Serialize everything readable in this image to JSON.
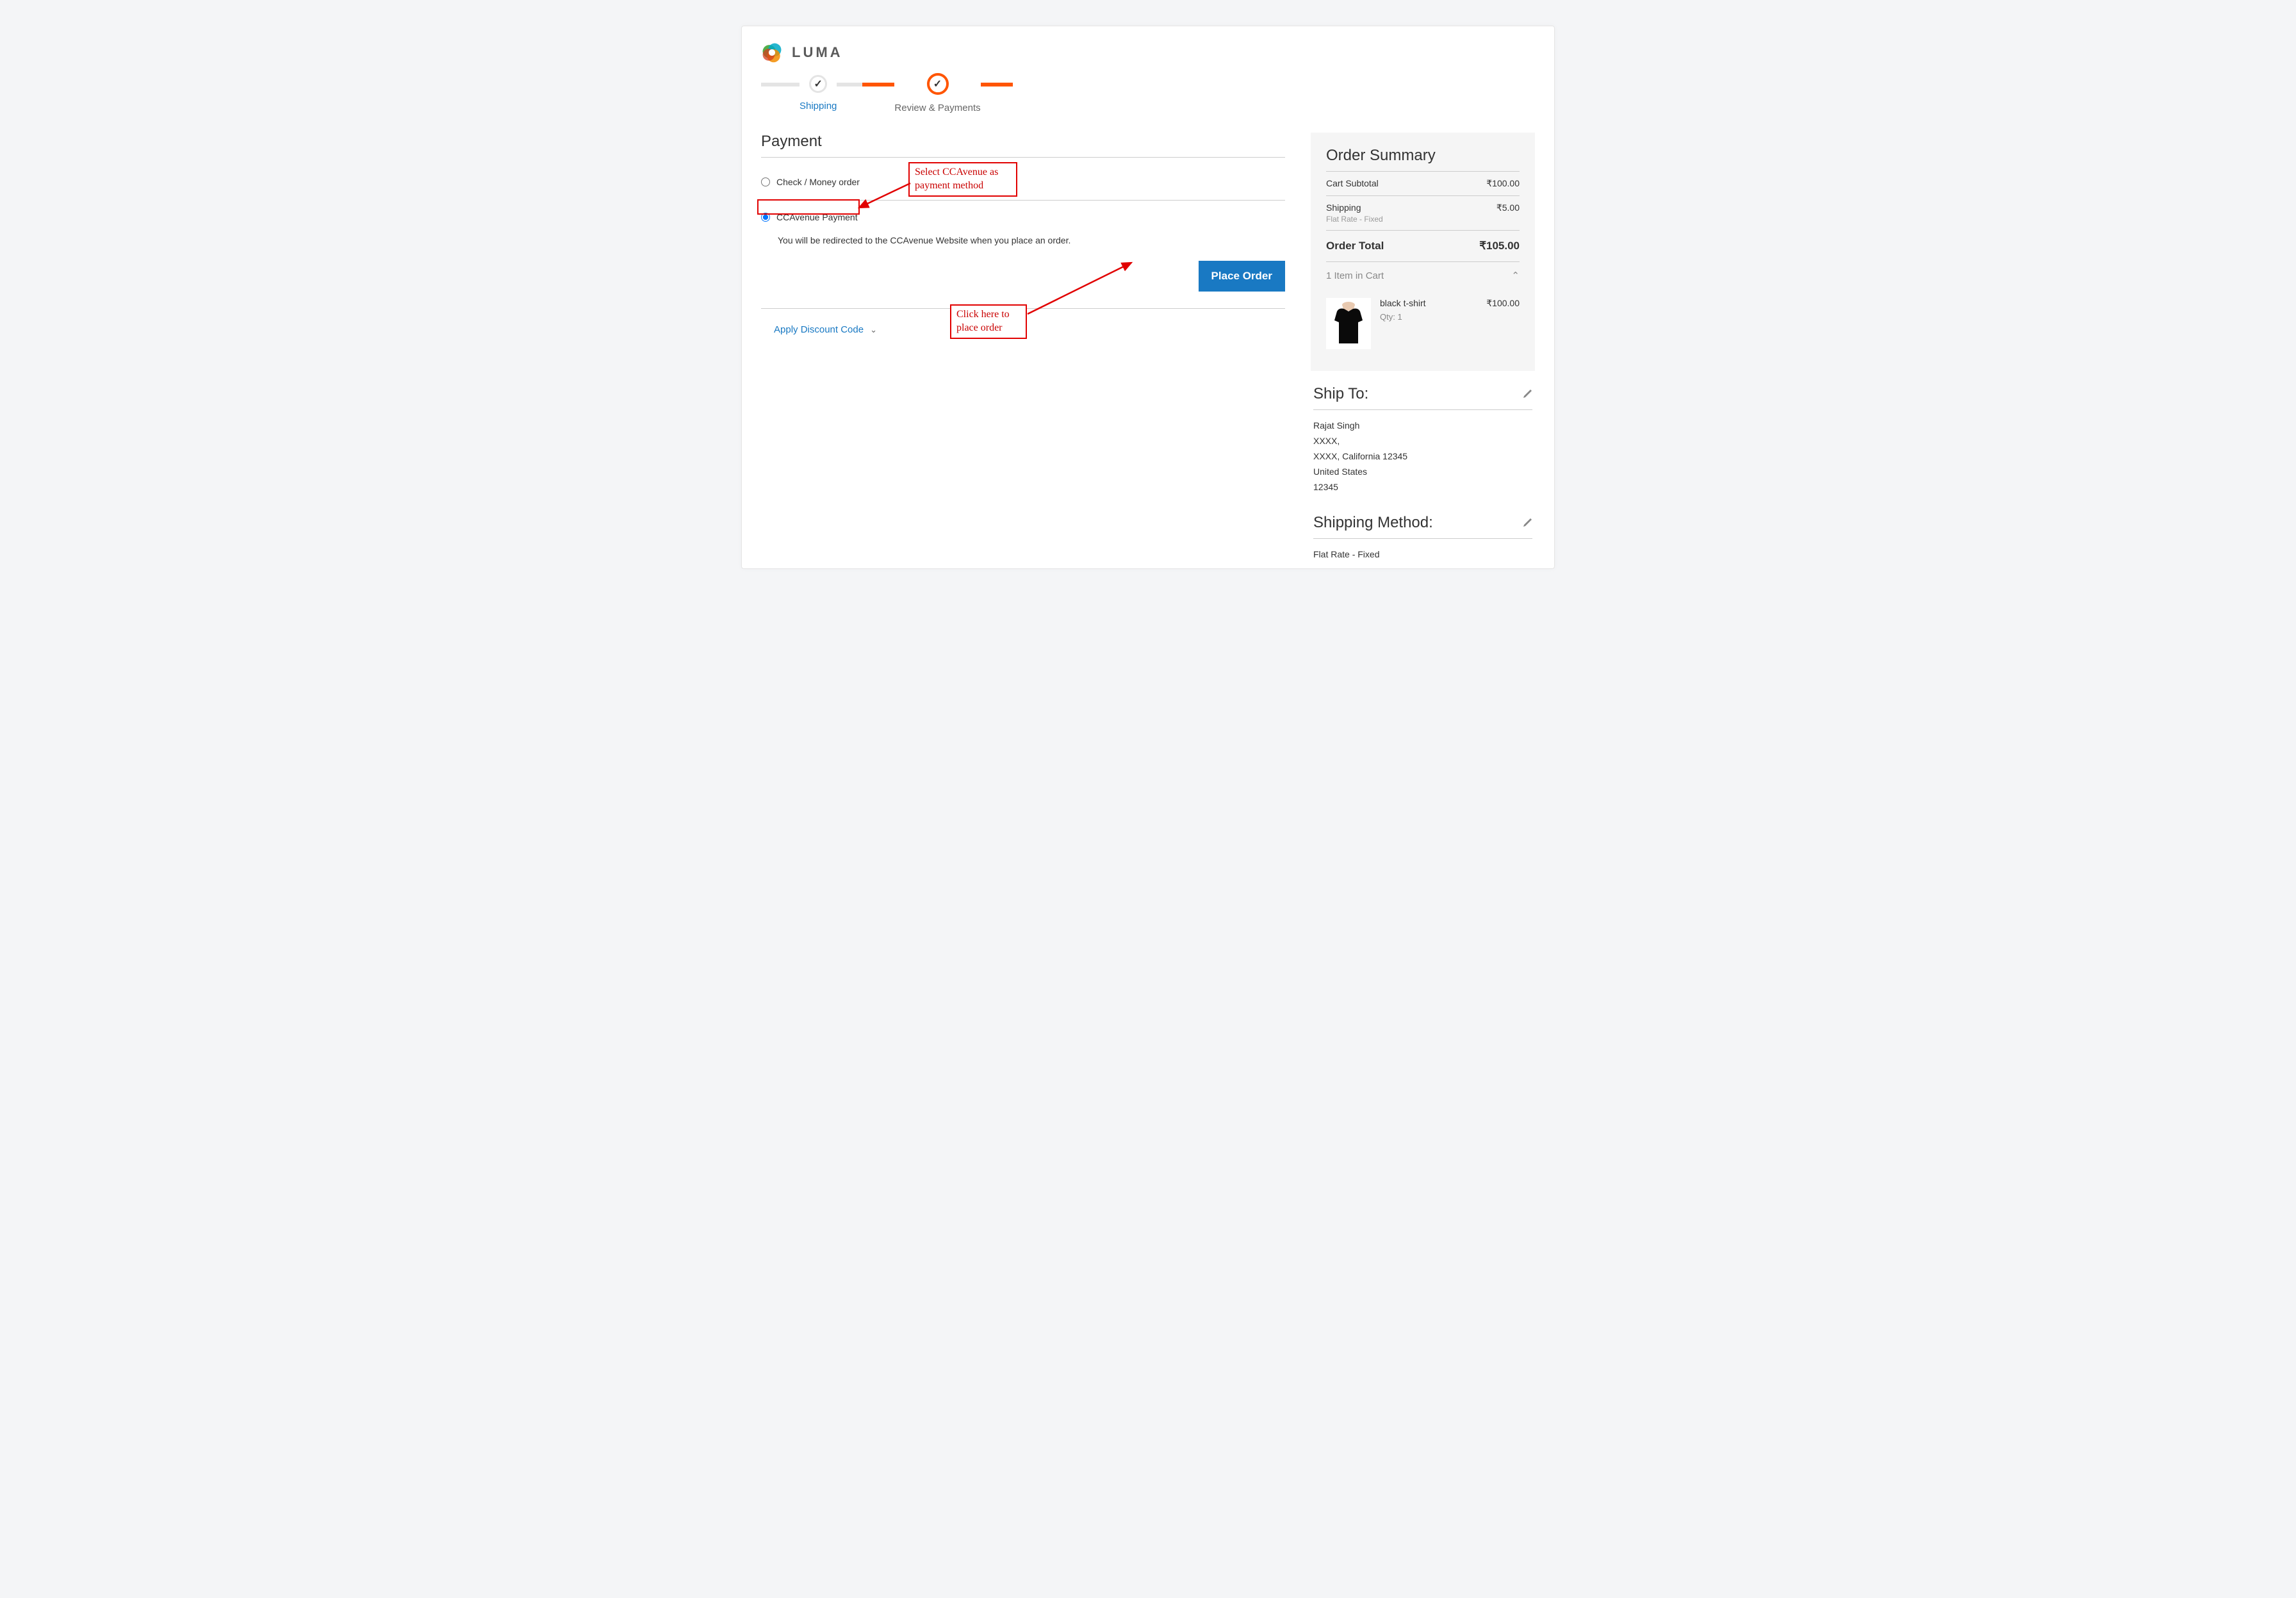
{
  "brand": {
    "name": "LUMA"
  },
  "progress": {
    "step1": "Shipping",
    "step2": "Review & Payments"
  },
  "page_title": "Payment",
  "payment_methods": {
    "check": "Check / Money order",
    "ccavenue": "CCAvenue Payment",
    "redirect_note": "You will be redirected to the CCAvenue Website when you place an order."
  },
  "buttons": {
    "place_order": "Place Order"
  },
  "discount": {
    "apply": "Apply Discount Code"
  },
  "summary": {
    "title": "Order Summary",
    "subtotal_label": "Cart Subtotal",
    "subtotal_value": "₹100.00",
    "shipping_label": "Shipping",
    "shipping_value": "₹5.00",
    "shipping_method": "Flat Rate - Fixed",
    "total_label": "Order Total",
    "total_value": "₹105.00",
    "cart_count": "1 Item in Cart",
    "item": {
      "name": "black t-shirt",
      "qty": "Qty: 1",
      "price": "₹100.00"
    }
  },
  "ship_to": {
    "title": "Ship To:",
    "lines": [
      "Rajat Singh",
      "XXXX,",
      "XXXX, California 12345",
      "United States",
      "12345"
    ]
  },
  "shipping_method_block": {
    "title": "Shipping Method:",
    "value": "Flat Rate - Fixed"
  },
  "annotations": {
    "select_cc": "Select CCAvenue as payment method",
    "click_place": "Click here to place order"
  }
}
